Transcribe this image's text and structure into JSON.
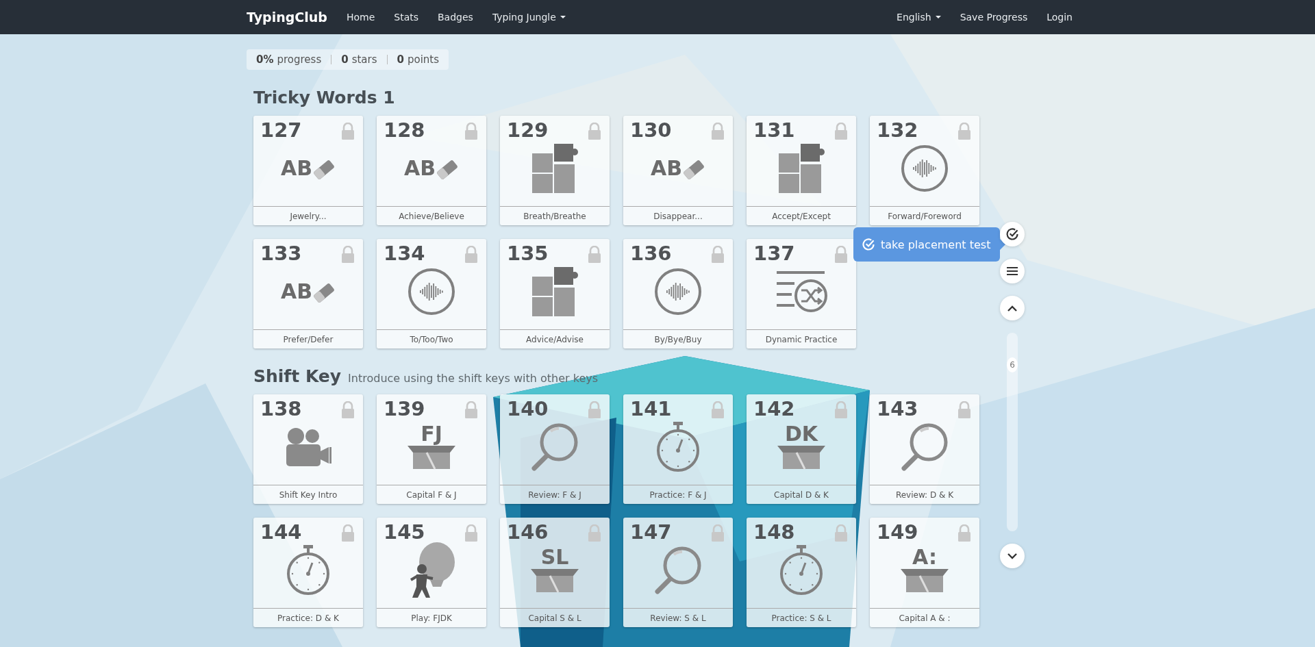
{
  "navbar": {
    "brand": "TypingClub",
    "links": [
      {
        "label": "Home",
        "dropdown": false
      },
      {
        "label": "Stats",
        "dropdown": false
      },
      {
        "label": "Badges",
        "dropdown": false
      },
      {
        "label": "Typing Jungle",
        "dropdown": true
      }
    ],
    "right_links": [
      {
        "label": "English",
        "dropdown": true
      },
      {
        "label": "Save Progress",
        "dropdown": false
      },
      {
        "label": "Login",
        "dropdown": false
      }
    ]
  },
  "stats": [
    {
      "value": "0%",
      "label": "progress"
    },
    {
      "value": "0",
      "label": "stars"
    },
    {
      "value": "0",
      "label": "points"
    }
  ],
  "sections": [
    {
      "title": "Tricky Words 1",
      "lessons": [
        {
          "number": "127",
          "label": "Jewelry...",
          "kind": "abc",
          "icon_text": "AB",
          "locked": true
        },
        {
          "number": "128",
          "label": "Achieve/Believe",
          "kind": "abc",
          "icon_text": "AB",
          "locked": true
        },
        {
          "number": "129",
          "label": "Breath/Breathe",
          "kind": "puzzle",
          "locked": true
        },
        {
          "number": "130",
          "label": "Disappear...",
          "kind": "abc",
          "icon_text": "AB",
          "locked": true
        },
        {
          "number": "131",
          "label": "Accept/Except",
          "kind": "puzzle",
          "locked": true
        },
        {
          "number": "132",
          "label": "Forward/Foreword",
          "kind": "audio",
          "locked": true
        },
        {
          "number": "133",
          "label": "Prefer/Defer",
          "kind": "abc",
          "icon_text": "AB",
          "locked": true
        },
        {
          "number": "134",
          "label": "To/Too/Two",
          "kind": "audio",
          "locked": true
        },
        {
          "number": "135",
          "label": "Advice/Advise",
          "kind": "puzzle",
          "locked": true
        },
        {
          "number": "136",
          "label": "By/Bye/Buy",
          "kind": "audio",
          "locked": true
        },
        {
          "number": "137",
          "label": "Dynamic Practice",
          "kind": "shuffle",
          "locked": true
        }
      ]
    },
    {
      "title": "Shift Key",
      "subtitle": "Introduce using the shift keys with other keys",
      "lessons": [
        {
          "number": "138",
          "label": "Shift Key Intro",
          "kind": "video",
          "locked": true
        },
        {
          "number": "139",
          "label": "Capital F & J",
          "kind": "box",
          "icon_text": "FJ",
          "locked": true
        },
        {
          "number": "140",
          "label": "Review: F & J",
          "kind": "review",
          "locked": true
        },
        {
          "number": "141",
          "label": "Practice: F & J",
          "kind": "timer",
          "locked": true
        },
        {
          "number": "142",
          "label": "Capital D & K",
          "kind": "box",
          "icon_text": "DK",
          "locked": true
        },
        {
          "number": "143",
          "label": "Review: D & K",
          "kind": "review",
          "locked": true
        },
        {
          "number": "144",
          "label": "Practice: D & K",
          "kind": "timer",
          "locked": true
        },
        {
          "number": "145",
          "label": "Play: FJDK",
          "kind": "game",
          "locked": true
        },
        {
          "number": "146",
          "label": "Capital S & L",
          "kind": "box",
          "icon_text": "SL",
          "locked": true
        },
        {
          "number": "147",
          "label": "Review: S & L",
          "kind": "review",
          "locked": true
        },
        {
          "number": "148",
          "label": "Practice: S & L",
          "kind": "timer",
          "locked": true
        },
        {
          "number": "149",
          "label": "Capital A & :",
          "kind": "box",
          "icon_text": "A:",
          "locked": true
        }
      ]
    }
  ],
  "placement_tooltip": {
    "label": "take placement test"
  },
  "scroll_rail": {
    "page": "6"
  }
}
